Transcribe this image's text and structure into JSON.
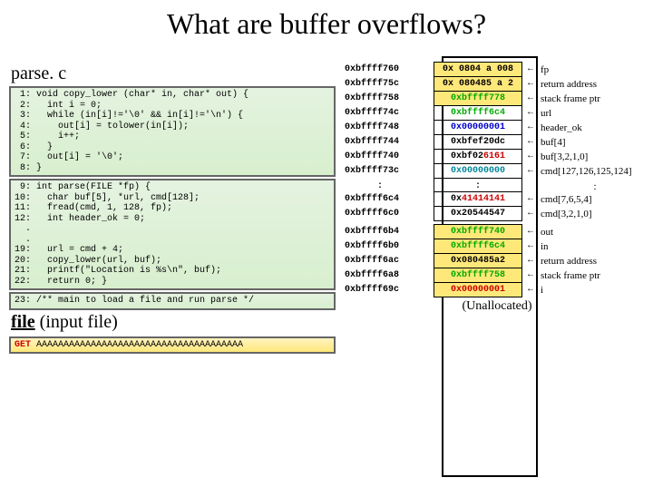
{
  "title": "What are buffer overflows?",
  "source_file": "parse. c",
  "code_block1": " 1: void copy_lower (char* in, char* out) {\n 2:   int i = 0;\n 3:   while (in[i]!='\\0' && in[i]!='\\n') {\n 4:     out[i] = tolower(in[i]);\n 5:     i++;\n 6:   }\n 7:   out[i] = '\\0';\n 8: }",
  "code_block2": " 9: int parse(FILE *fp) {\n10:   char buf[5], *url, cmd[128];\n11:   fread(cmd, 1, 128, fp);\n12:   int header_ok = 0;\n  .\n  .\n19:   url = cmd + 4;\n20:   copy_lower(url, buf);\n21:   printf(\"Location is %s\\n\", buf);\n22:   return 0; }",
  "code_block3": "23: /** main to load a file and run parse */",
  "input_label_prefix": "file",
  "input_label_rest": " (input file)",
  "input_get": "GET",
  "input_payload": " AAAAAAAAAAAAAAAAAAAAAAAAAAAAAAAAAAAAAA",
  "rows": [
    {
      "a": "0xbffff760",
      "v": "0x 0804 a 008",
      "y": 1,
      "cls": "",
      "l": "fp"
    },
    {
      "a": "0xbffff75c",
      "v": "0x 080485 a 2",
      "y": 1,
      "cls": "",
      "l": "return address"
    },
    {
      "a": "0xbffff758",
      "v": "0xbffff778",
      "y": 1,
      "cls": "green",
      "l": "stack frame ptr"
    },
    {
      "a": "0xbffff74c",
      "v": "0xbffff6c4",
      "cls": "green",
      "l": "url"
    },
    {
      "a": "0xbffff748",
      "v": "0x00000001",
      "cls": "bluetxt",
      "l": "header_ok"
    },
    {
      "a": "0xbffff744",
      "v": "0xbfef20dc",
      "cls": "",
      "l": "        buf[4]"
    },
    {
      "a": "0xbffff740",
      "v": "0xbf026161",
      "cls": "",
      "vextra": "redtail",
      "l": "buf[3,2,1,0]"
    },
    {
      "a": "0xbffff73c",
      "v": "0x00000000",
      "cls": "teal",
      "l": "cmd[127,126,125,124]"
    },
    {
      "dots": true
    },
    {
      "a": "0xbffff6c4",
      "v": "0x41414141",
      "cls": "redtxt",
      "l": "cmd[7,6,5,4]"
    },
    {
      "a": "0xbffff6c0",
      "v": "0x20544547",
      "cls": "",
      "l": "cmd[3,2,1,0]"
    },
    {
      "gap": true
    },
    {
      "a": "0xbffff6b4",
      "v": "0xbffff740",
      "y": 1,
      "cls": "green",
      "l": "out"
    },
    {
      "a": "0xbffff6b0",
      "v": "0xbffff6c4",
      "y": 1,
      "cls": "green",
      "l": "in"
    },
    {
      "a": "0xbffff6ac",
      "v": "0x080485a2",
      "y": 1,
      "cls": "",
      "l": "return address"
    },
    {
      "a": "0xbffff6a8",
      "v": "0xbffff758",
      "y": 1,
      "cls": "green",
      "l": "stack frame ptr"
    },
    {
      "a": "0xbffff69c",
      "v": "0x00000001",
      "y": 1,
      "cls": "redtxt",
      "l": "i"
    }
  ],
  "unallocated": "(Unallocated)"
}
